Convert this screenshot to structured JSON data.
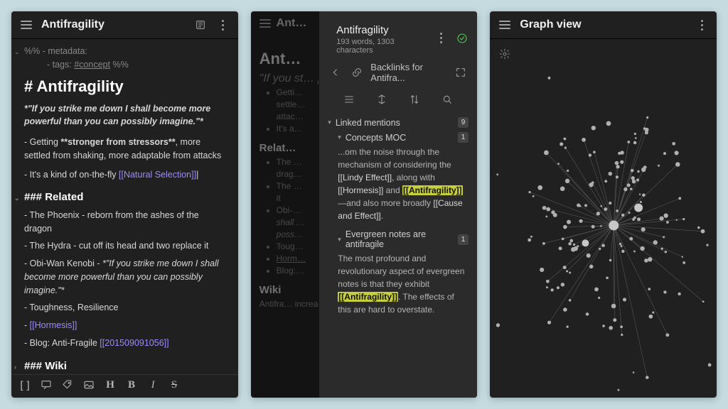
{
  "panel1": {
    "title": "Antifragility",
    "meta_prefix": "%% - metadata:",
    "meta_tags_label": "- tags:",
    "meta_tag": "#concept",
    "meta_suffix": "%%",
    "h1": "# Antifragility",
    "quote": "*\"If you strike me down I shall become more powerful than you can possibly imagine.\"*",
    "bullet1_pre": "- Getting ",
    "bullet1_bold": "**stronger from stressors**",
    "bullet1_post": ", more settled from shaking, more adaptable from attacks",
    "bullet2_pre": "- It's a kind of on-the-fly ",
    "bullet2_link": "[[Natural Selection]]",
    "bullet2_cursor": "|",
    "h3_related": "### Related",
    "rel1": "- The Phoenix - reborn from the ashes of the dragon",
    "rel2": "- The Hydra - cut off its head and two replace it",
    "rel3_pre": "- Obi-Wan Kenobi - ",
    "rel3_quote": "*\"If you strike me down I shall become more powerful than you can possibly imagine.\"*",
    "rel4": "- Toughness, Resilience",
    "rel5_pre": "- ",
    "rel5_link": "[[Hormesis]]",
    "rel6_pre": "- Blog: Anti-Fragile ",
    "rel6_link": "[[201509091056]]",
    "h3_wiki": "### Wiki",
    "format_icons": [
      "[]",
      "💬",
      "🏷",
      "🖼",
      "H",
      "B",
      "I",
      "S"
    ]
  },
  "panel2": {
    "back_h1": "Ant…",
    "back_quote": "\"If you st… powerfu…",
    "back_bullets_a": [
      "Getti…",
      "settle…",
      "attac…",
      "It's a…"
    ],
    "back_h3_rel": "Relat…",
    "back_bullets_b": [
      "The …",
      "drag…",
      "The …",
      "it",
      "Obi-…",
      "shall …",
      "poss…",
      "Toug…",
      "Horm…",
      "Blog:…"
    ],
    "back_h3_wiki": "Wiki",
    "back_last": "Antifra… increas…",
    "ov_title": "Antifragility",
    "ov_stats": "193 words, 1303 characters",
    "crumb": "Backlinks for Antifra...",
    "linked_label": "Linked mentions",
    "linked_count": "9",
    "item1_title": "Concepts MOC",
    "item1_count": "1",
    "item1_body_a": "...om the noise through the mechanism of considering the ",
    "item1_link1": "[[Lindy Effect]]",
    "item1_body_b": ", along with ",
    "item1_link2": "[[Hormesis]]",
    "item1_body_c": " and ",
    "item1_hl": "[[Antifragility]]",
    "item1_body_d": "—and also more broadly ",
    "item1_link3": "[[Cause and Effect]]",
    "item1_body_e": ".",
    "item2_title": "Evergreen notes are antifragile",
    "item2_count": "1",
    "item2_body_a": "The most profound and revolutionary aspect of evergreen notes is that they exhibit ",
    "item2_hl": "[[Antifragility]]",
    "item2_body_b": ". The effects of this are hard to overstate."
  },
  "panel3": {
    "title": "Graph view"
  }
}
